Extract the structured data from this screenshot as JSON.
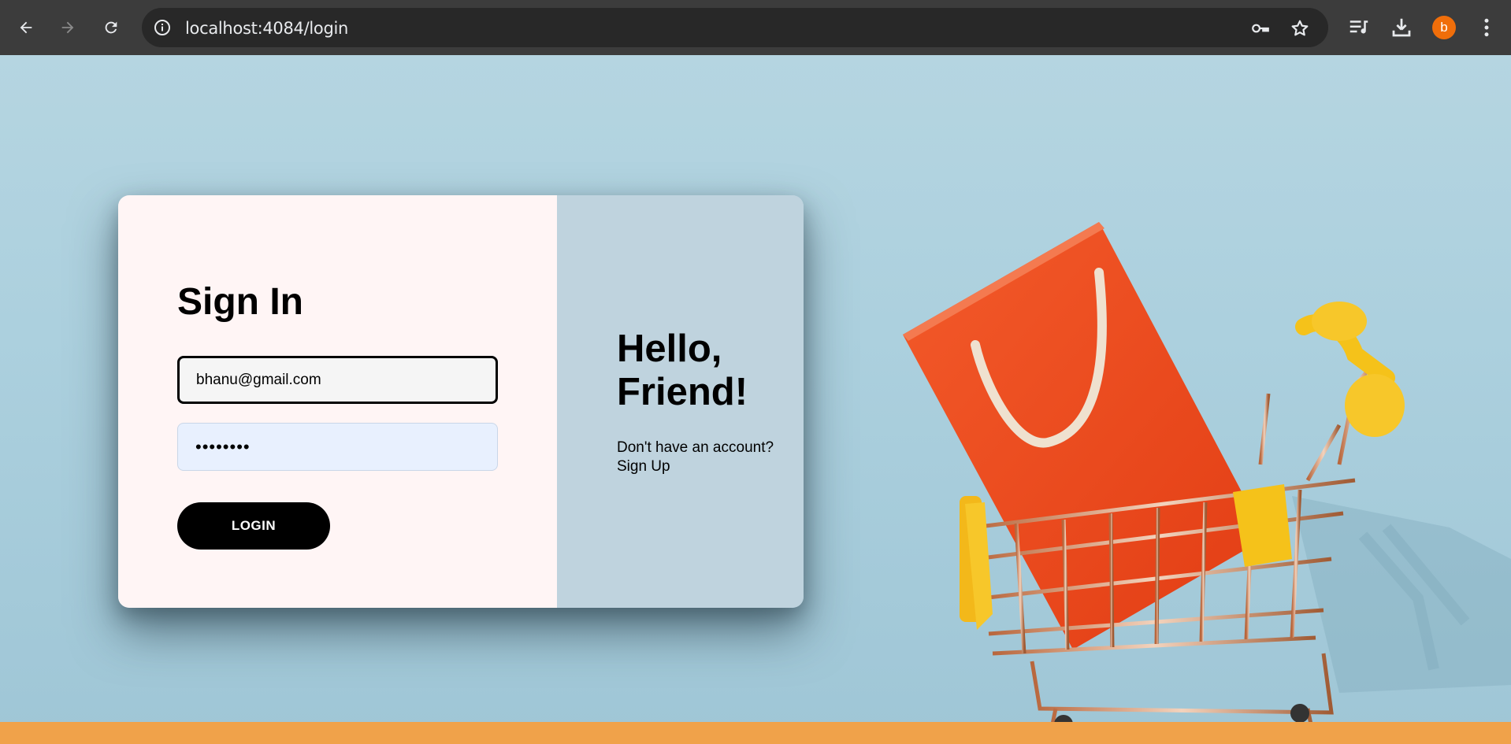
{
  "browser": {
    "url_host": "localhost",
    "url_rest": ":4084/login",
    "avatar_letter": "b",
    "avatar_color": "#f06e0a"
  },
  "login_form": {
    "title": "Sign In",
    "email_value": "bhanu@gmail.com",
    "password_value": "••••••••",
    "login_button_label": "LOGIN"
  },
  "welcome_panel": {
    "title_line1": "Hello,",
    "title_line2": "Friend!",
    "prompt_text": "Don't have an account?",
    "signup_link_label": "Sign Up"
  },
  "icons": {
    "back": "back-arrow-icon",
    "forward": "forward-arrow-icon",
    "reload": "reload-icon",
    "site_info": "info-icon",
    "passwords": "key-icon",
    "bookmark": "star-icon",
    "media": "media-playlist-icon",
    "downloads": "download-icon",
    "menu": "kebab-menu-icon"
  },
  "colors": {
    "chrome_bg": "#3c3c3c",
    "omnibox_bg": "#282828",
    "page_bg": "#acd0de",
    "card_left_bg": "#fff5f5",
    "card_right_bg": "#bfd3de",
    "button_bg": "#000000",
    "bag": "#f04a1c",
    "cart_handle": "#f5c21a",
    "floor": "#f0a24a"
  }
}
